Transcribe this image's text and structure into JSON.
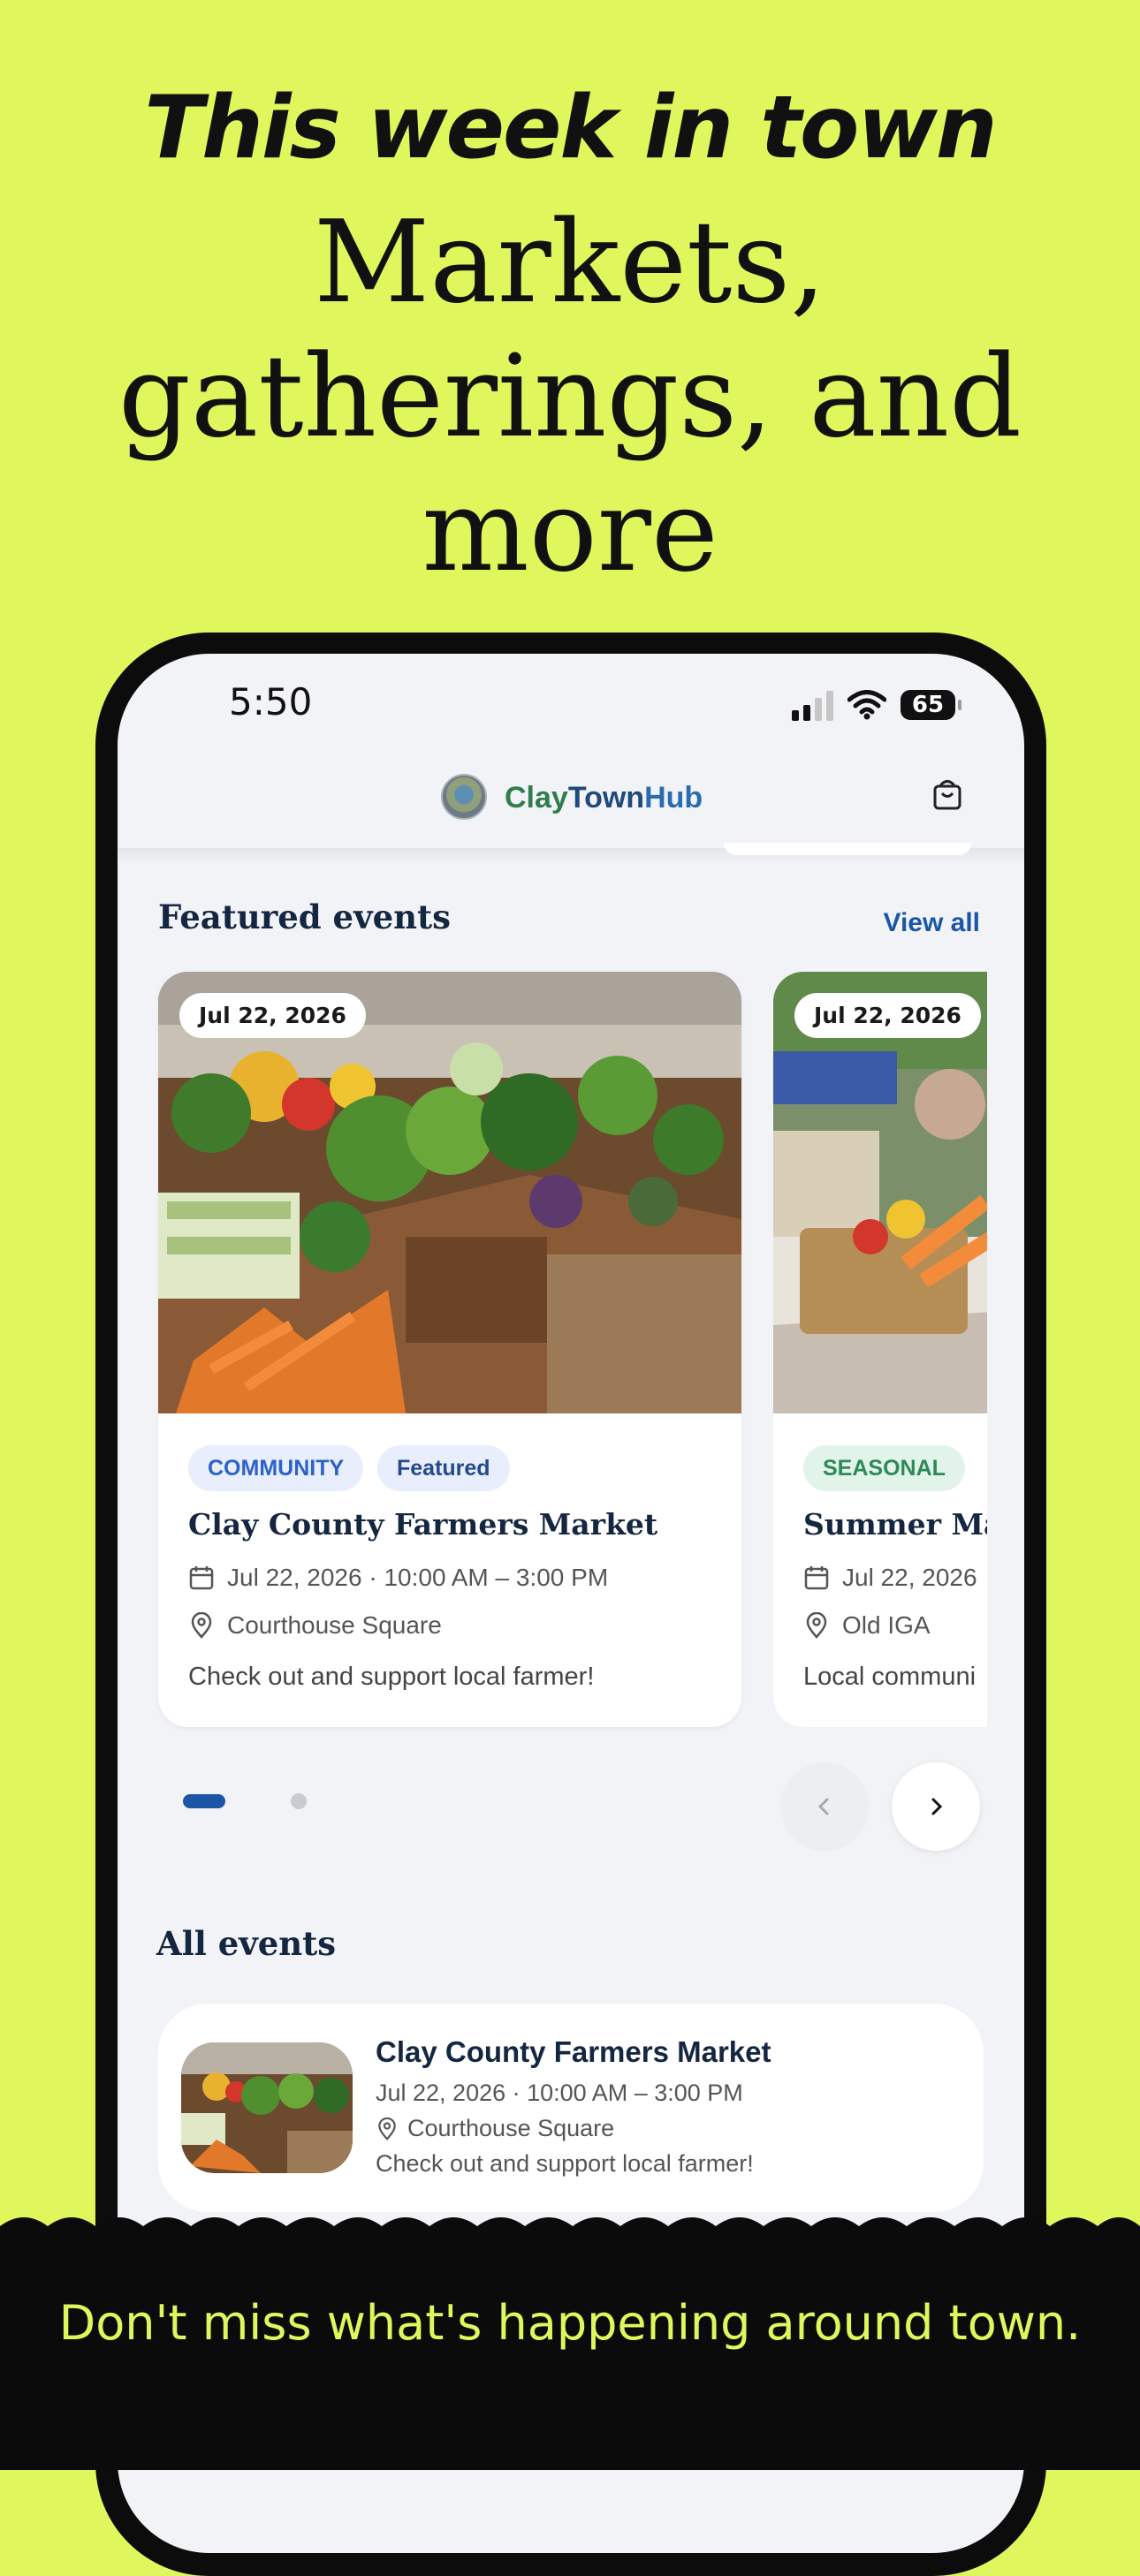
{
  "marketing": {
    "headline_top": "This week in town",
    "headline_main": "Markets, gatherings, and more",
    "tagline": "Don't miss what's happening around town."
  },
  "status_bar": {
    "time": "5:50",
    "battery": "65"
  },
  "app": {
    "name_part1": "Clay",
    "name_part2": "Town",
    "name_part3": "Hub"
  },
  "featured": {
    "title": "Featured events",
    "view_all": "View all",
    "cards": [
      {
        "date_chip": "Jul 22, 2026",
        "tags": [
          "COMMUNITY",
          "Featured"
        ],
        "title": "Clay County Farmers Market",
        "datetime": "Jul 22, 2026 · 10:00 AM – 3:00 PM",
        "location": "Courthouse Square",
        "description": "Check out and support local farmer!"
      },
      {
        "date_chip": "Jul 22, 2026",
        "tags": [
          "SEASONAL"
        ],
        "title": "Summer Ma",
        "datetime": "Jul 22, 2026",
        "location": "Old IGA",
        "description": "Local communi"
      }
    ],
    "carousel": {
      "active_index": 0,
      "count": 2
    }
  },
  "all_events": {
    "title": "All events",
    "items": [
      {
        "title": "Clay County Farmers Market",
        "datetime": "Jul 22, 2026 · 10:00 AM – 3:00 PM",
        "location": "Courthouse Square",
        "description": "Check out and support local farmer!"
      }
    ]
  },
  "colors": {
    "background": "#dff75c",
    "primary": "#1b56a6",
    "navy": "#142640",
    "brand_green": "#2f7d4b"
  },
  "icons": [
    "shopping-bag-icon",
    "calendar-icon",
    "location-pin-icon",
    "chevron-left-icon",
    "chevron-right-icon",
    "wifi-icon",
    "signal-icon",
    "battery-icon"
  ]
}
